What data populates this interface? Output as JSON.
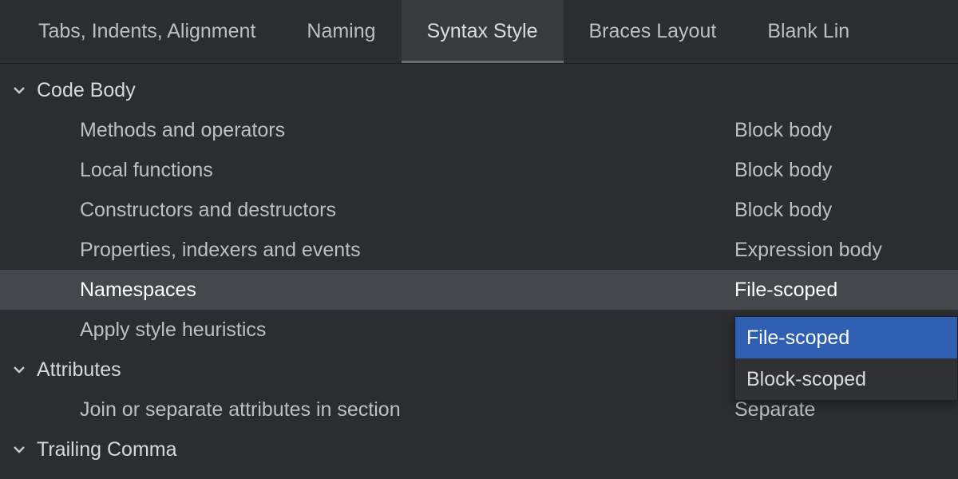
{
  "tabs": {
    "tia": "Tabs, Indents, Alignment",
    "naming": "Naming",
    "syntax": "Syntax Style",
    "braces": "Braces Layout",
    "blank": "Blank Lin"
  },
  "sections": {
    "code_body": {
      "title": "Code Body",
      "rows": {
        "methods": {
          "label": "Methods and operators",
          "value": "Block body"
        },
        "local_fns": {
          "label": "Local functions",
          "value": "Block body"
        },
        "ctors": {
          "label": "Constructors and destructors",
          "value": "Block body"
        },
        "props": {
          "label": "Properties, indexers and events",
          "value": "Expression body"
        },
        "namespaces": {
          "label": "Namespaces",
          "value": "File-scoped"
        },
        "heuristics": {
          "label": "Apply style heuristics",
          "value": ""
        }
      }
    },
    "attributes": {
      "title": "Attributes",
      "rows": {
        "join": {
          "label": "Join or separate attributes in section",
          "value": "Separate"
        }
      }
    },
    "trailing_comma": {
      "title": "Trailing Comma"
    }
  },
  "dropdown": {
    "opt_file": "File-scoped",
    "opt_block": "Block-scoped"
  }
}
